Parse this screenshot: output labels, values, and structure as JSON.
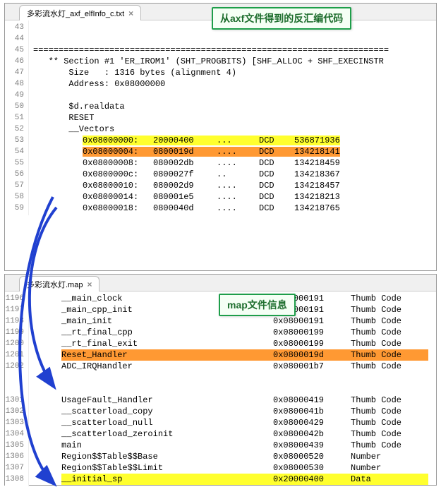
{
  "callouts": {
    "top": "从axf文件得到的反汇编代码",
    "mid": "map文件信息"
  },
  "axf": {
    "tab": "多彩流水灯_axf_elfInfo_c.txt",
    "line_start": 43,
    "header1": "** Section #1 'ER_IROM1' (SHT_PROGBITS) [SHF_ALLOC + SHF_EXECINSTR",
    "size_line": "Size   : 1316 bytes (alignment 4)",
    "addr_line": "Address: 0x08000000",
    "realdata": "$d.realdata",
    "reset": "RESET",
    "vectors": "__Vectors",
    "rows": [
      {
        "addr": "0x08000000:",
        "hex": "20000400",
        "dots": "...",
        "instr": "DCD",
        "val": "536871936",
        "hl": "yellow"
      },
      {
        "addr": "0x08000004:",
        "hex": "0800019d",
        "dots": "....",
        "instr": "DCD",
        "val": "134218141",
        "hl": "orange"
      },
      {
        "addr": "0x08000008:",
        "hex": "080002db",
        "dots": "....",
        "instr": "DCD",
        "val": "134218459",
        "hl": ""
      },
      {
        "addr": "0x0800000c:",
        "hex": "0800027f",
        "dots": "..",
        "instr": "DCD",
        "val": "134218367",
        "hl": ""
      },
      {
        "addr": "0x08000010:",
        "hex": "080002d9",
        "dots": "....",
        "instr": "DCD",
        "val": "134218457",
        "hl": ""
      },
      {
        "addr": "0x08000014:",
        "hex": "080001e5",
        "dots": "....",
        "instr": "DCD",
        "val": "134218213",
        "hl": ""
      },
      {
        "addr": "0x08000018:",
        "hex": "0800040d",
        "dots": "....",
        "instr": "DCD",
        "val": "134218765",
        "hl": ""
      }
    ]
  },
  "map": {
    "tab": "多彩流水灯.map",
    "top_start_line": 1196,
    "top_rows": [
      {
        "name": "__main_clock",
        "addr": "0x08000191",
        "type": "Thumb Code",
        "hl": ""
      },
      {
        "name": "_main_cpp_init",
        "addr": "0x08000191",
        "type": "Thumb Code",
        "hl": ""
      },
      {
        "name": "_main_init",
        "addr": "0x08000191",
        "type": "Thumb Code",
        "hl": ""
      },
      {
        "name": "__rt_final_cpp",
        "addr": "0x08000199",
        "type": "Thumb Code",
        "hl": ""
      },
      {
        "name": "__rt_final_exit",
        "addr": "0x08000199",
        "type": "Thumb Code",
        "hl": ""
      },
      {
        "name": "Reset_Handler",
        "addr": "0x0800019d",
        "type": "Thumb Code",
        "hl": "orange"
      },
      {
        "name": "ADC_IRQHandler",
        "addr": "0x080001b7",
        "type": "Thumb Code",
        "hl": ""
      }
    ],
    "bot_start_line": 1301,
    "bot_rows": [
      {
        "name": "UsageFault_Handler",
        "addr": "0x08000419",
        "type": "Thumb Code",
        "hl": ""
      },
      {
        "name": "__scatterload_copy",
        "addr": "0x0800041b",
        "type": "Thumb Code",
        "hl": ""
      },
      {
        "name": "__scatterload_null",
        "addr": "0x08000429",
        "type": "Thumb Code",
        "hl": ""
      },
      {
        "name": "__scatterload_zeroinit",
        "addr": "0x0800042b",
        "type": "Thumb Code",
        "hl": ""
      },
      {
        "name": "main",
        "addr": "0x08000439",
        "type": "Thumb Code",
        "hl": ""
      },
      {
        "name": "Region$$Table$$Base",
        "addr": "0x08000520",
        "type": "Number",
        "hl": ""
      },
      {
        "name": "Region$$Table$$Limit",
        "addr": "0x08000530",
        "type": "Number",
        "hl": ""
      },
      {
        "name": "__initial_sp",
        "addr": "0x20000400",
        "type": "Data",
        "hl": "yellow"
      }
    ]
  }
}
